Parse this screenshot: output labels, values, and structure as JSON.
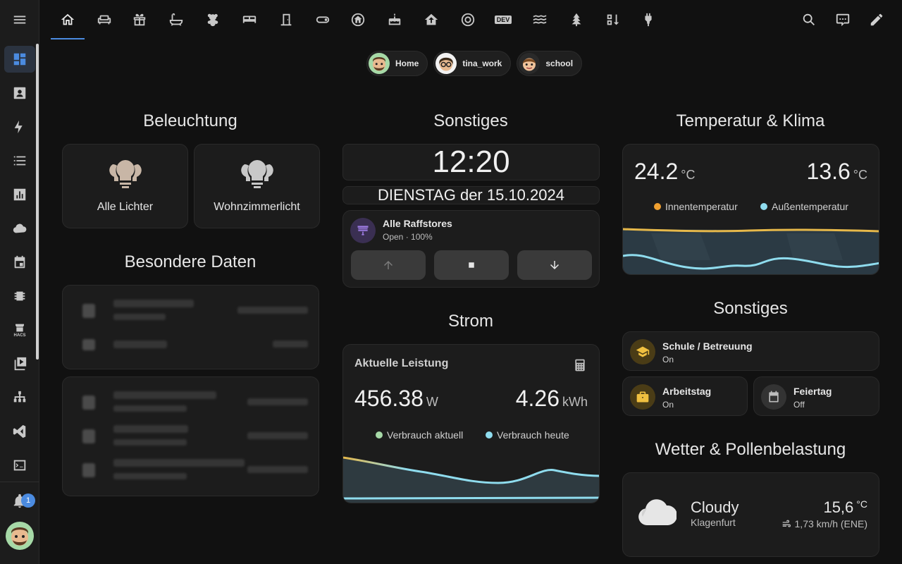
{
  "sidebar": {
    "items": [
      {
        "name": "overview-icon"
      },
      {
        "name": "person-card-icon"
      },
      {
        "name": "lightning-icon"
      },
      {
        "name": "list-icon"
      },
      {
        "name": "chart-icon"
      },
      {
        "name": "cloud-icon"
      },
      {
        "name": "calendar-icon"
      },
      {
        "name": "chip-icon"
      },
      {
        "name": "store-icon"
      },
      {
        "name": "media-icon"
      },
      {
        "name": "network-icon"
      },
      {
        "name": "vscode-icon"
      },
      {
        "name": "terminal-icon"
      }
    ],
    "notification_count": "1",
    "hacs_label": "HACS"
  },
  "topbar": {
    "dev_label": "DEV"
  },
  "persons": [
    {
      "name": "Home"
    },
    {
      "name": "tina_work"
    },
    {
      "name": "school"
    }
  ],
  "sections": {
    "lighting": "Beleuchtung",
    "special": "Besondere Daten",
    "misc1": "Sonstiges",
    "power": "Strom",
    "climate": "Temperatur & Klima",
    "misc2": "Sonstiges",
    "weather": "Wetter & Pollenbelastung"
  },
  "lights": [
    {
      "label": "Alle Lichter"
    },
    {
      "label": "Wohnzimmerlicht"
    }
  ],
  "clock": {
    "time": "12:20",
    "date": "DIENSTAG der 15.10.2024"
  },
  "blinds": {
    "name": "Alle Raffstores",
    "state": "Open · 100%"
  },
  "power": {
    "title": "Aktuelle Leistung",
    "current_value": "456.38",
    "current_unit": "W",
    "today_value": "4.26",
    "today_unit": "kWh",
    "legend_current": "Verbrauch aktuell",
    "legend_today": "Verbrauch heute",
    "color_current": "#a6d9a7",
    "color_today": "#8fdcee"
  },
  "climate": {
    "inside_value": "24.2",
    "inside_unit": "°C",
    "outside_value": "13.6",
    "outside_unit": "°C",
    "legend_inside": "Innentemperatur",
    "legend_outside": "Außentemperatur",
    "color_inside": "#f0a030",
    "color_outside": "#8fdcee"
  },
  "entities": [
    {
      "name": "Schule / Betreuung",
      "state": "On"
    },
    {
      "name": "Arbeitstag",
      "state": "On"
    },
    {
      "name": "Feiertag",
      "state": "Off"
    }
  ],
  "weather": {
    "condition": "Cloudy",
    "location": "Klagenfurt",
    "temperature": "15,6",
    "temp_unit": "°C",
    "wind": "1,73 km/h (ENE)"
  }
}
